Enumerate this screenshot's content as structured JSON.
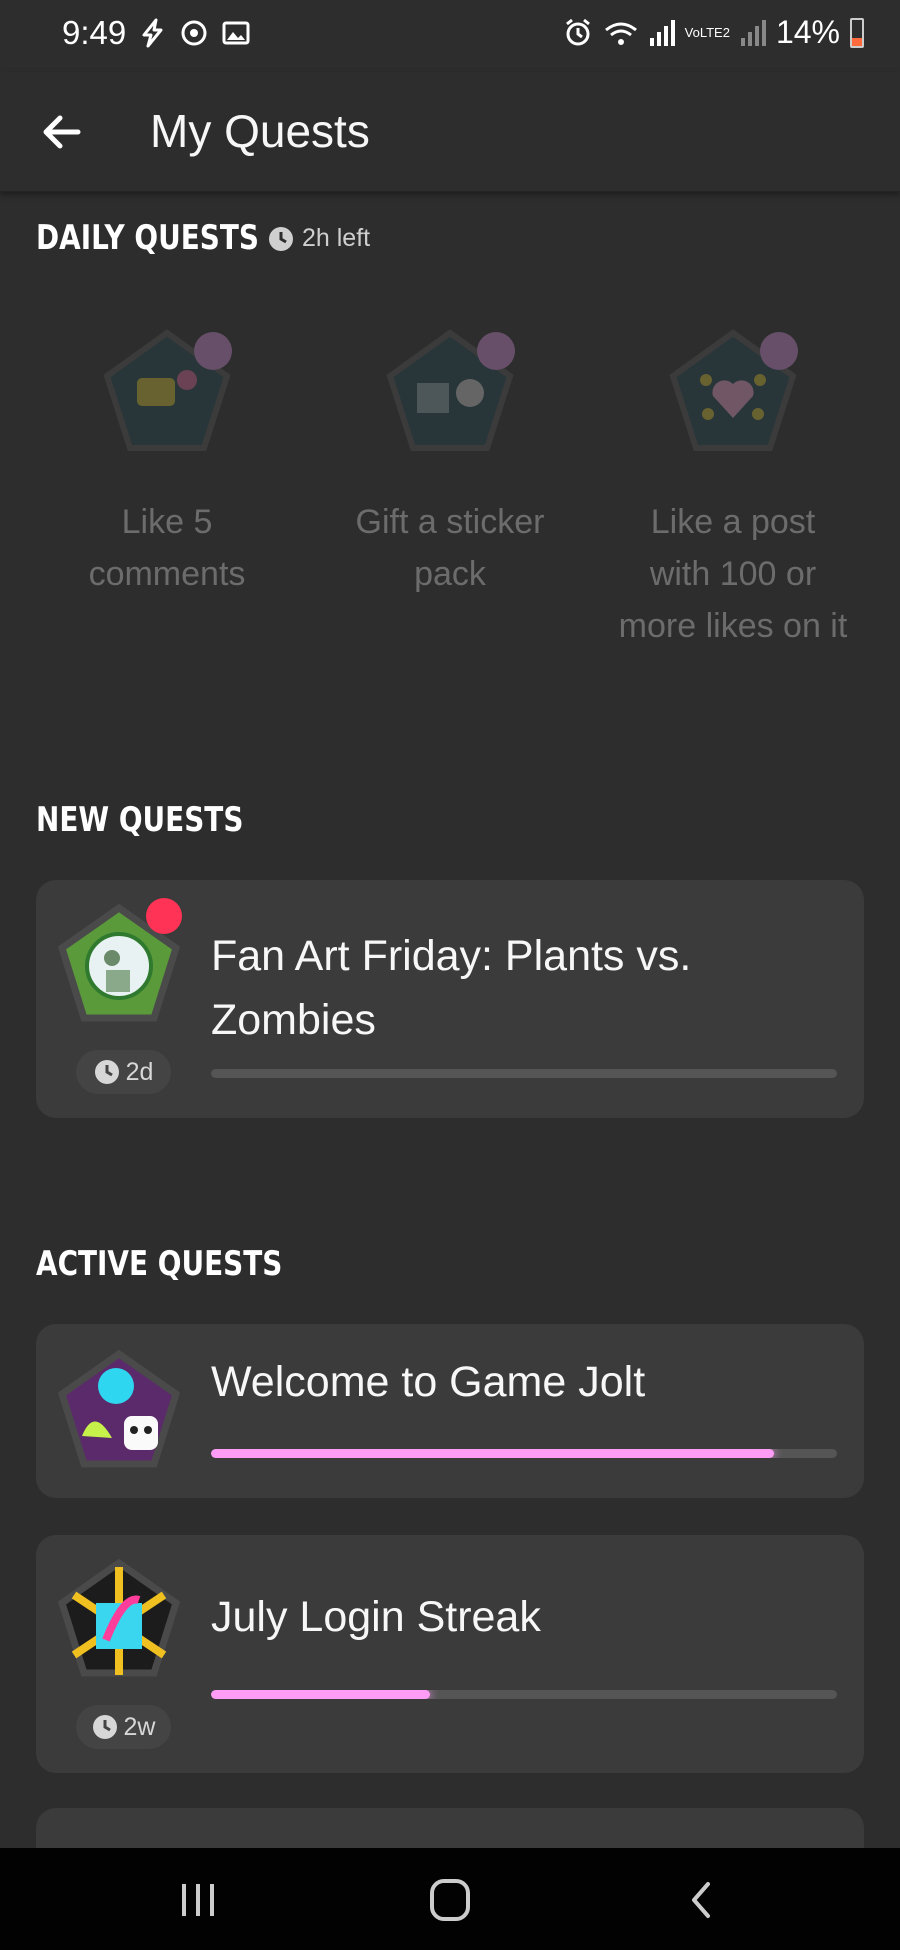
{
  "status_bar": {
    "time": "9:49",
    "battery": "14%",
    "network_label": "VoLTE2",
    "colors": {
      "battery_low": "#ff6a3d"
    }
  },
  "header": {
    "title": "My Quests",
    "back_icon": "arrow-left-icon"
  },
  "daily_quests": {
    "title": "DAILY QUESTS",
    "time_left": "2h left",
    "items": [
      {
        "label": "Like 5 comments",
        "icon": "comment-heart-icon"
      },
      {
        "label": "Gift a sticker pack",
        "icon": "gift-sticker-icon"
      },
      {
        "label": "Like a post with 100 or more likes on it",
        "icon": "hearts-icon"
      }
    ]
  },
  "new_quests": {
    "title": "NEW QUESTS",
    "items": [
      {
        "title": "Fan Art Friday: Plants vs. Zombies",
        "timer": "2d",
        "progress": 0
      }
    ]
  },
  "active_quests": {
    "title": "ACTIVE QUESTS",
    "items": [
      {
        "title": "Welcome to Game Jolt",
        "progress": 0.9
      },
      {
        "title": "July Login Streak",
        "timer": "2w",
        "progress": 0.35
      }
    ]
  },
  "nav_bar": {
    "recent_icon": "recent-apps-icon",
    "home_icon": "home-icon",
    "back_icon": "back-chevron-icon"
  },
  "colors": {
    "background": "#2d2d2d",
    "card": "#3b3b3b",
    "progress_accent": "#ff9cf5",
    "alert_dot": "#ff3355"
  }
}
